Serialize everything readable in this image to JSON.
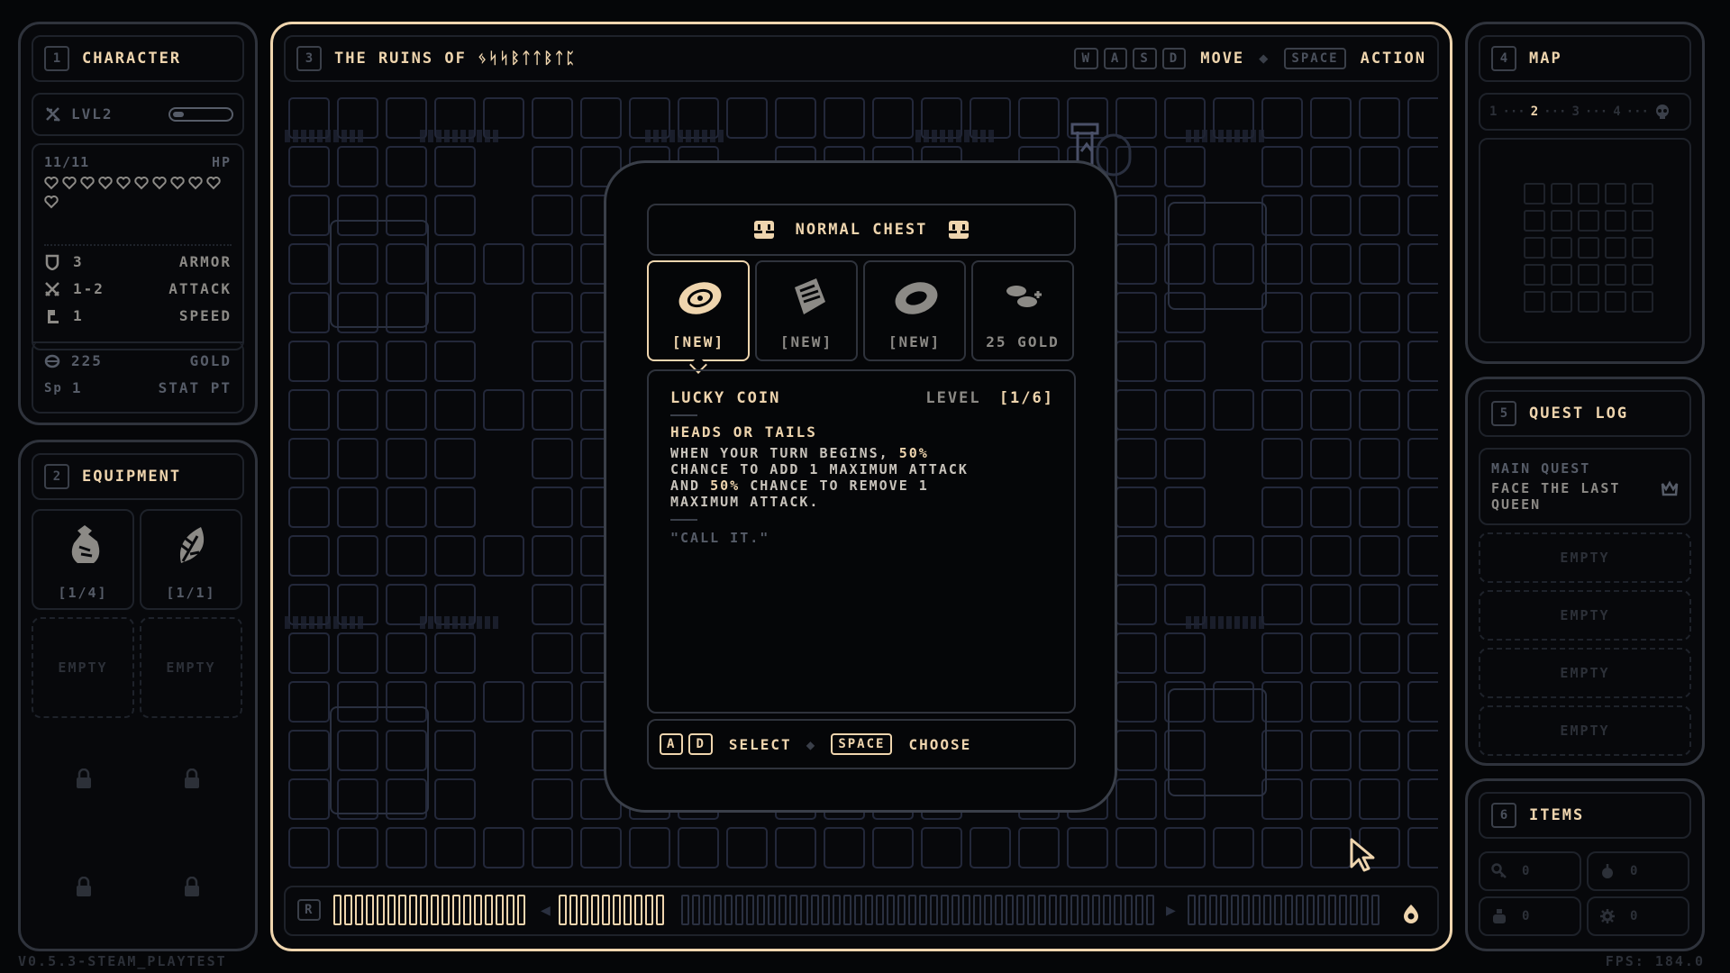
{
  "character": {
    "num": "1",
    "title": "Character",
    "level": "LVL2",
    "level_progress": 0.2,
    "hp_text": "11/11",
    "hp_label": "HP",
    "hearts": 11,
    "stats": [
      {
        "icon": "shield-icon",
        "value": "3",
        "label": "Armor"
      },
      {
        "icon": "swords-icon",
        "value": "1-2",
        "label": "Attack"
      },
      {
        "icon": "boot-icon",
        "value": "1",
        "label": "Speed"
      }
    ],
    "gold_value": "225",
    "gold_label": "Gold",
    "sp_icon": "Sp",
    "sp_value": "1",
    "sp_label": "Stat Pt"
  },
  "equipment": {
    "num": "2",
    "title": "Equipment",
    "items": [
      {
        "icon": "bag-icon",
        "count": "[1/4]"
      },
      {
        "icon": "leaf-icon",
        "count": "[1/1]"
      }
    ],
    "empty": [
      "Empty",
      "Empty"
    ]
  },
  "main": {
    "num": "3",
    "title": "The Ruins of ᛃᛋᛋᛒᛏᛏᛒᛏᛈ",
    "keys": [
      "W",
      "A",
      "S",
      "D"
    ],
    "move_label": "Move",
    "space_key": "Space",
    "action_label": "Action",
    "prog_key": "R"
  },
  "chest": {
    "title": "Normal Chest",
    "slots": [
      {
        "icon": "coin-icon",
        "label": "[New]"
      },
      {
        "icon": "scroll-icon",
        "label": "[New]"
      },
      {
        "icon": "ring-icon",
        "label": "[New]"
      },
      {
        "icon": "gold-coins-icon",
        "label": "25 Gold"
      }
    ],
    "item_name": "Lucky Coin",
    "level_label": "Level",
    "level_value": "[1/6]",
    "ability_name": "Heads or Tails",
    "desc_lines": [
      "When your turn begins, 50%",
      "chance to add 1 maximum attack",
      "and 50% chance to remove 1",
      "maximum attack."
    ],
    "quote": "\"Call it.\"",
    "key_a": "A",
    "key_d": "D",
    "select_label": "Select",
    "space_key": "Space",
    "choose_label": "Choose"
  },
  "map": {
    "num": "4",
    "title": "Map",
    "floors": [
      "1",
      "2",
      "3",
      "4"
    ],
    "current_floor": "2"
  },
  "quest": {
    "num": "5",
    "title": "Quest Log",
    "main_label": "Main Quest",
    "main_text": "Face the last queen",
    "empty": [
      "Empty",
      "Empty",
      "Empty",
      "Empty"
    ]
  },
  "items": {
    "num": "6",
    "title": "Items",
    "slots": [
      {
        "icon": "key-icon",
        "value": "0"
      },
      {
        "icon": "bomb-icon",
        "value": "0"
      },
      {
        "icon": "potion-icon",
        "value": "0"
      },
      {
        "icon": "gear-icon",
        "value": "0"
      }
    ]
  },
  "footer": {
    "version": "v0.5.3-steam_playtest",
    "fps": "FPS: 184.0"
  }
}
